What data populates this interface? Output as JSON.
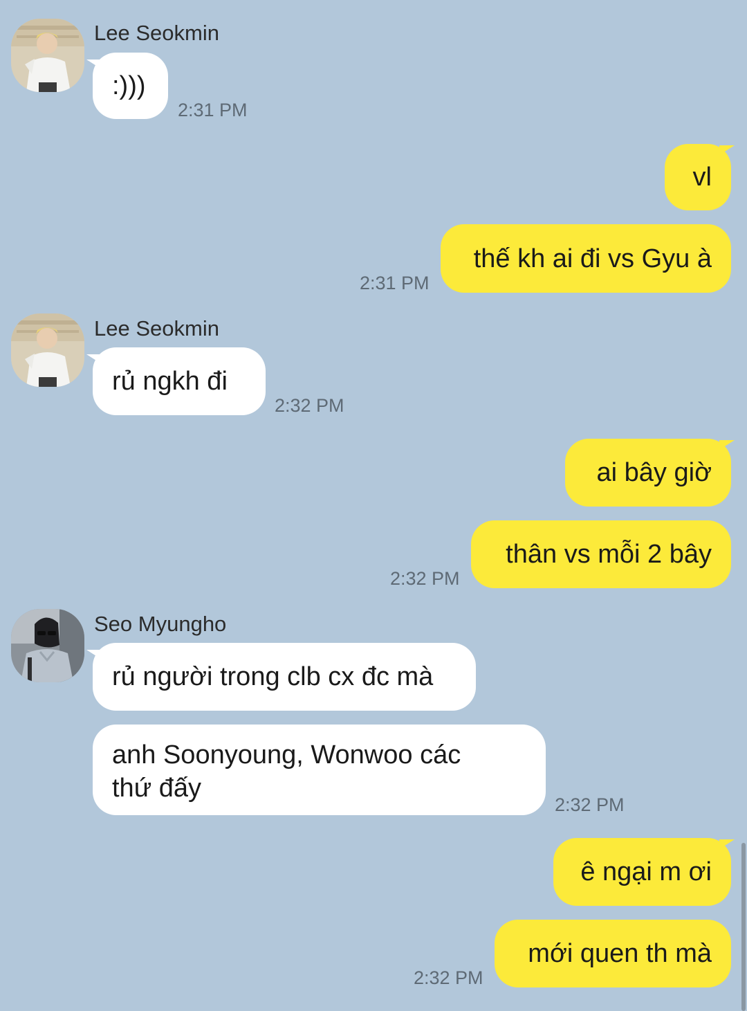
{
  "chat": {
    "messages": [
      {
        "sender": "Lee Seokmin",
        "text": ":)))",
        "time": "2:31 PM"
      },
      {
        "text": "vl"
      },
      {
        "text": "thế kh ai đi vs Gyu à",
        "time": "2:31 PM"
      },
      {
        "sender": "Lee Seokmin",
        "text": "rủ ngkh đi",
        "time": "2:32 PM"
      },
      {
        "text": "ai bây giờ"
      },
      {
        "text": "thân vs mỗi 2 bây",
        "time": "2:32 PM"
      },
      {
        "sender": "Seo Myungho",
        "text": "rủ người trong clb cx đc mà"
      },
      {
        "text": "anh Soonyoung, Wonwoo các thứ đấy",
        "time": "2:32 PM"
      },
      {
        "text": "ê ngại m ơi"
      },
      {
        "text": "mới quen th mà",
        "time": "2:32 PM"
      }
    ]
  },
  "colors": {
    "background": "#b2c7da",
    "incoming_bubble": "#ffffff",
    "outgoing_bubble": "#fcea3a",
    "timestamp": "#5e6a75"
  },
  "icons": {
    "avatar_lee_seokmin": "avatar-lee-seokmin",
    "avatar_seo_myungho": "avatar-seo-myungho"
  }
}
